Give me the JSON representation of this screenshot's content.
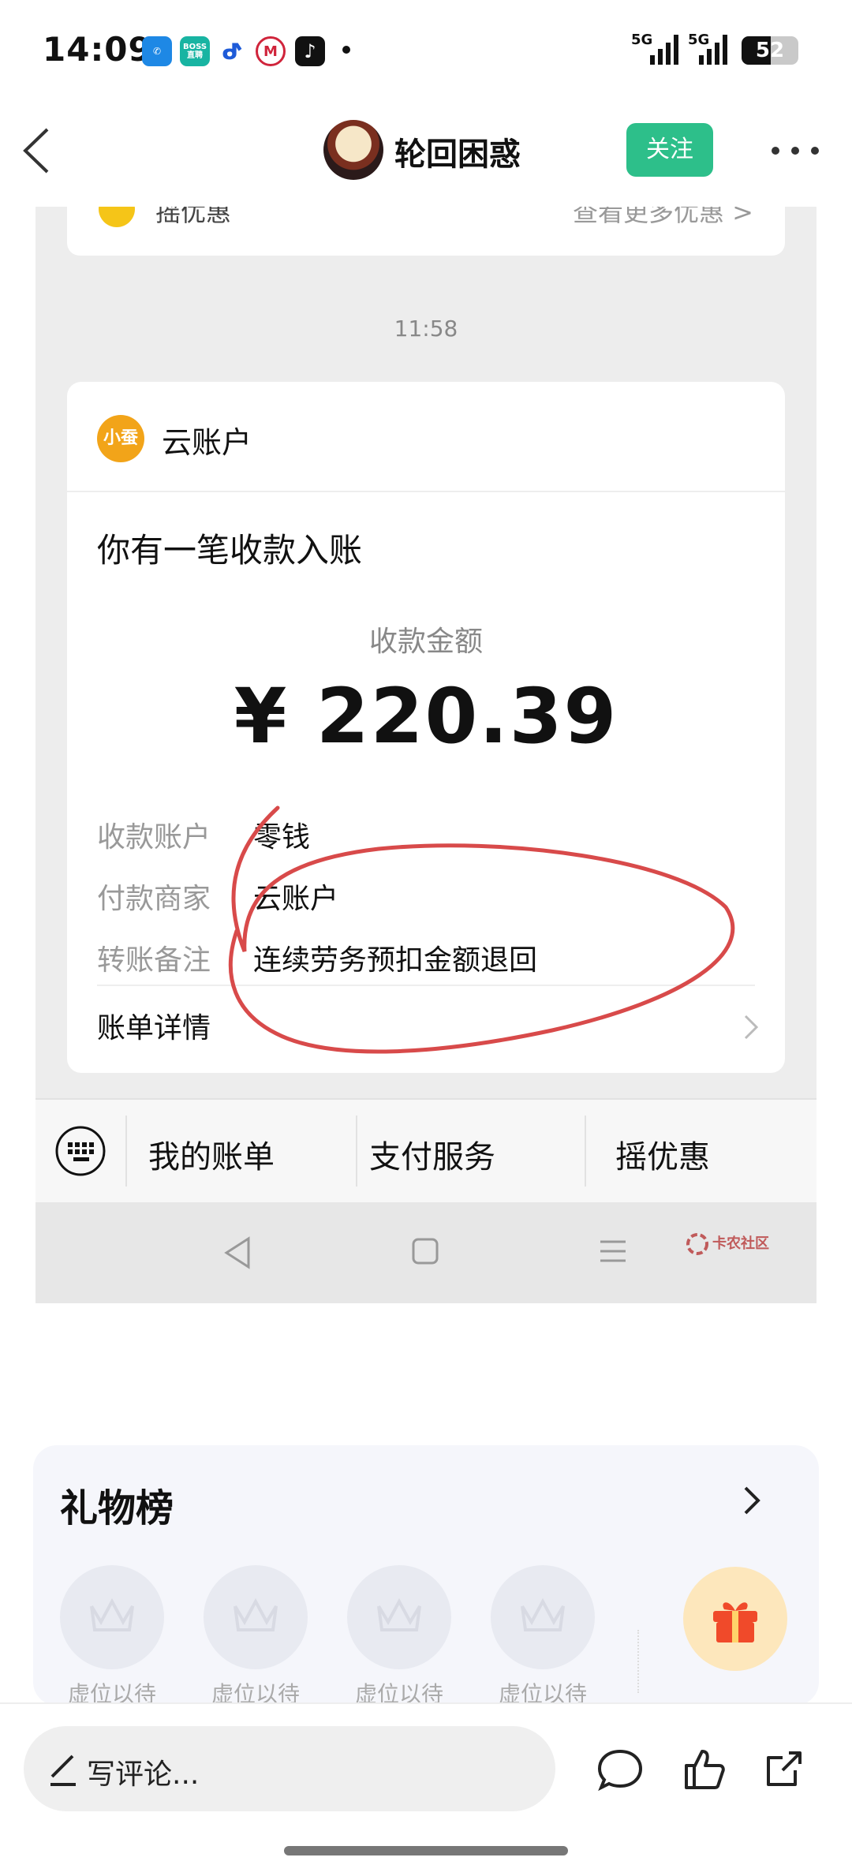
{
  "status_bar": {
    "time": "14:09",
    "network_1": "5G",
    "network_2": "5G",
    "battery": "52",
    "battery_level": 0.52,
    "apps": [
      {
        "icon": "phone-icon",
        "color": "#1e88e5",
        "text": ""
      },
      {
        "icon": "boss-zhipin-icon",
        "color": "#18b4a2",
        "text": "BOSS\n直聘"
      },
      {
        "icon": "baidu-app-icon",
        "color": "#1e5bd8",
        "text": ""
      },
      {
        "icon": "cmb-bank-icon",
        "color": "#d0243b",
        "text": ""
      },
      {
        "icon": "tiktok-icon",
        "color": "#111111",
        "text": ""
      }
    ]
  },
  "header": {
    "username": "轮回困惑",
    "follow_label": "关注"
  },
  "screenshot": {
    "top_card": {
      "left_text": "摇优惠",
      "right_text": "查看更多优惠 >"
    },
    "message_time": "11:58",
    "payment_card": {
      "logo_text": "小蚕",
      "account_name": "云账户",
      "title": "你有一笔收款入账",
      "amount_label": "收款金额",
      "amount": "¥ 220.39",
      "rows": [
        {
          "label": "收款账户",
          "value": "零钱"
        },
        {
          "label": "付款商家",
          "value": "云账户"
        },
        {
          "label": "转账备注",
          "value": "连续劳务预扣金额退回"
        }
      ],
      "detail_label": "账单详情"
    },
    "service_bar": [
      "我的账单",
      "支付服务",
      "摇优惠"
    ],
    "watermark": "卡农社区"
  },
  "gift_board": {
    "title": "礼物榜",
    "slots": [
      "虚位以待",
      "虚位以待",
      "虚位以待",
      "虚位以待"
    ]
  },
  "bottom_bar": {
    "comment_placeholder": "写评论..."
  },
  "colors": {
    "follow_green": "#2dbf8a",
    "annotation_red": "#d84a4a",
    "logo_orange": "#f2a419"
  }
}
